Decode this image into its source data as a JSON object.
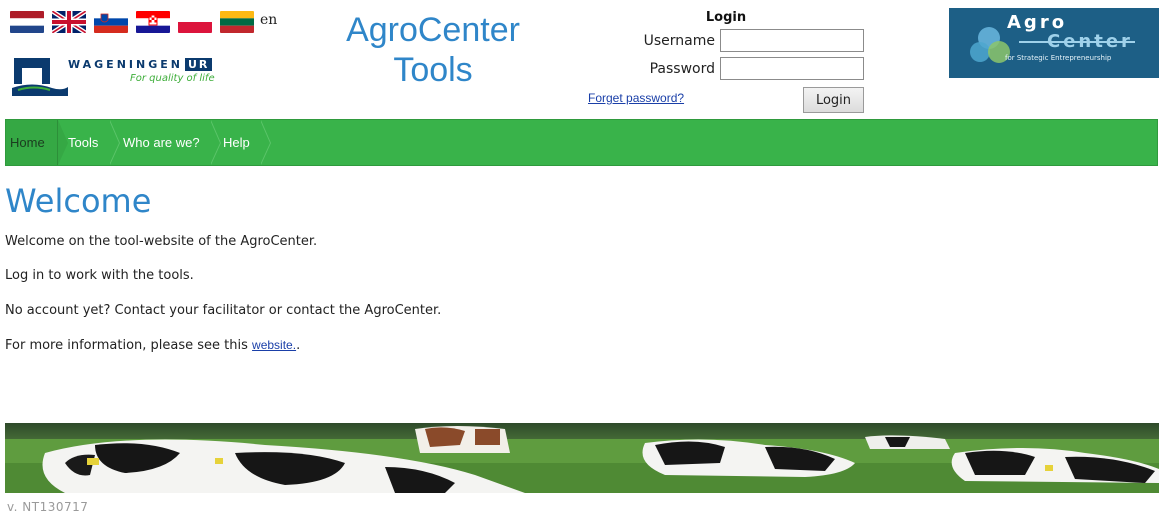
{
  "header": {
    "language_code": "en",
    "flags": [
      "netherlands-flag",
      "united-kingdom-flag",
      "slovenia-flag",
      "croatia-flag",
      "poland-flag",
      "lithuania-flag"
    ],
    "app_title_line1": "AgroCenter",
    "app_title_line2": "Tools",
    "wur_logo": {
      "name": "WAGENINGEN",
      "suffix": "UR",
      "tagline": "For quality of life"
    },
    "agro_logo": {
      "line1": "Agro",
      "line2": "Center",
      "tagline": "for Strategic Entrepreneurship"
    }
  },
  "login": {
    "heading": "Login",
    "username_label": "Username",
    "password_label": "Password",
    "username_value": "",
    "password_value": "",
    "forget_password": "Forget password?",
    "button_label": "Login"
  },
  "nav": {
    "items": [
      "Home",
      "Tools",
      "Who are we?",
      "Help"
    ],
    "color": "#39b34a"
  },
  "content": {
    "title": "Welcome",
    "paragraphs": [
      "Welcome on the tool-website of the AgroCenter.",
      "Log in to work with the tools.",
      "No account yet? Contact your facilitator or contact the AgroCenter."
    ],
    "more_info_prefix": "For more information, please see this ",
    "more_info_link": "website.",
    "more_info_suffix": "."
  },
  "footer": {
    "version": "v. NT130717"
  },
  "colors": {
    "title_blue": "#2f86c9",
    "nav_green": "#39b34a",
    "link_blue": "#1a3fa8"
  }
}
